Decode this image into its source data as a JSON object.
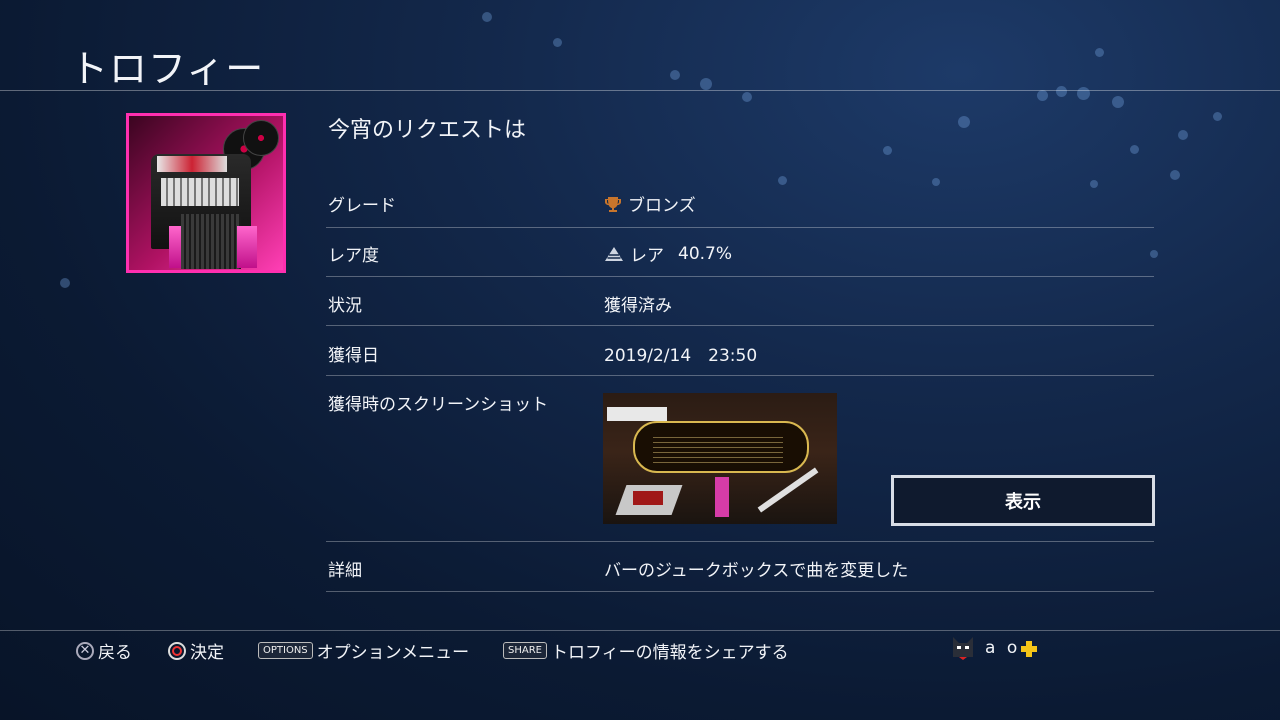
{
  "header": {
    "title": "トロフィー"
  },
  "trophy": {
    "name": "今宵のリクエストは",
    "icon": "jukebox-trophy-icon",
    "rows": [
      {
        "label": "グレード",
        "value": "ブロンズ",
        "icon": "bronze-trophy-icon"
      },
      {
        "label": "レア度",
        "value": "レア",
        "extra": "40.7%",
        "icon": "rarity-pyramid-icon"
      },
      {
        "label": "状況",
        "value": "獲得済み"
      },
      {
        "label": "獲得日",
        "value": "2019/2/14　23:50"
      },
      {
        "label": "獲得時のスクリーンショット"
      },
      {
        "label": "詳細",
        "value": "バーのジュークボックスで曲を変更した"
      }
    ],
    "view_button": "表示"
  },
  "footer": {
    "back": "戻る",
    "confirm": "決定",
    "options_key": "OPTIONS",
    "options": "オプションメニュー",
    "share_key": "SHARE",
    "share": "トロフィーの情報をシェアする",
    "user": "a o"
  },
  "colors": {
    "accent_pink": "#ff2fb0",
    "bronze": "#c8752c",
    "plus_yellow": "#f5c518",
    "bg": "#13284b"
  }
}
